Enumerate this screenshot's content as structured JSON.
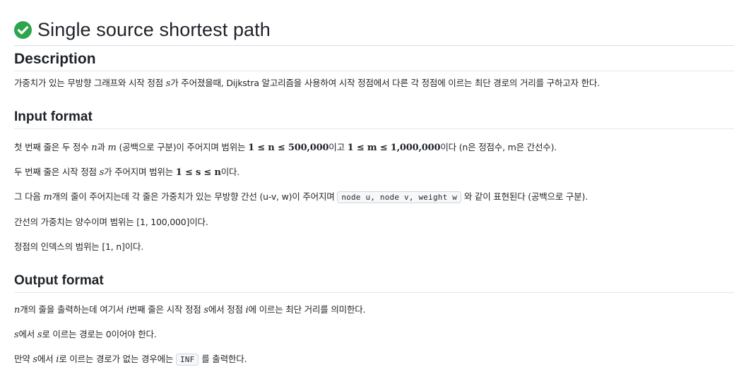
{
  "header": {
    "title": "Single source shortest path",
    "status_icon": "check-circle-icon",
    "status_color": "#2da44e"
  },
  "description": {
    "heading": "Description",
    "p1": {
      "a": "가중치가 있는 무방향 그래프와 시작 정점 ",
      "s": "s",
      "b": "가 주어졌을때, Dijkstra 알고리즘을 사용하여 시작 정점에서 다른 각 정점에 이르는 최단 경로의 거리를 구하고자 한다."
    }
  },
  "input_format": {
    "heading": "Input format",
    "l1": {
      "a": "첫 번째 줄은 두 정수 ",
      "n": "n",
      "b": "과 ",
      "m": "m",
      "c": " (공백으로 구분)이 주어지며 범위는 ",
      "r1": "1 ≤ n ≤ 500,000",
      "d": "이고 ",
      "r2": "1 ≤ m ≤ 1,000,000",
      "e": "이다 (n은 정점수, m은 간선수)."
    },
    "l2": {
      "a": "두 번째 줄은 시작 정점 ",
      "s": "s",
      "b": "가 주어지며 범위는 ",
      "r": "1 ≤ s ≤ n",
      "c": "이다."
    },
    "l3": {
      "a": "그 다음 ",
      "m": "m",
      "b": "개의 줄이 주어지는데 각 줄은 가중치가 있는 무방향 간선 (u-v, w)이 주어지며 ",
      "code": "node u, node v, weight w",
      "c": " 와 같이 표현된다 (공백으로 구분)."
    },
    "l4": "간선의 가중치는 양수이며 범위는 [1, 100,000]이다.",
    "l5": "정점의 인덱스의 범위는 [1, n]이다."
  },
  "output_format": {
    "heading": "Output format",
    "l1": {
      "n": "n",
      "a": "개의 줄을 출력하는데 여기서 ",
      "i": "i",
      "b": "번째 줄은 시작 정점 ",
      "s": "s",
      "c": "에서 정점 ",
      "i2": "i",
      "d": "에 이르는 최단 거리를 의미한다."
    },
    "l2": {
      "s": "s",
      "a": "에서 ",
      "s2": "s",
      "b": "로 이르는 경로는 0이어야 한다."
    },
    "l3": {
      "a": "만약 ",
      "s": "s",
      "b": "에서 ",
      "i": "i",
      "c": "로 이르는 경로가 없는 경우에는 ",
      "code": "INF",
      "d": " 를 출력한다."
    }
  }
}
